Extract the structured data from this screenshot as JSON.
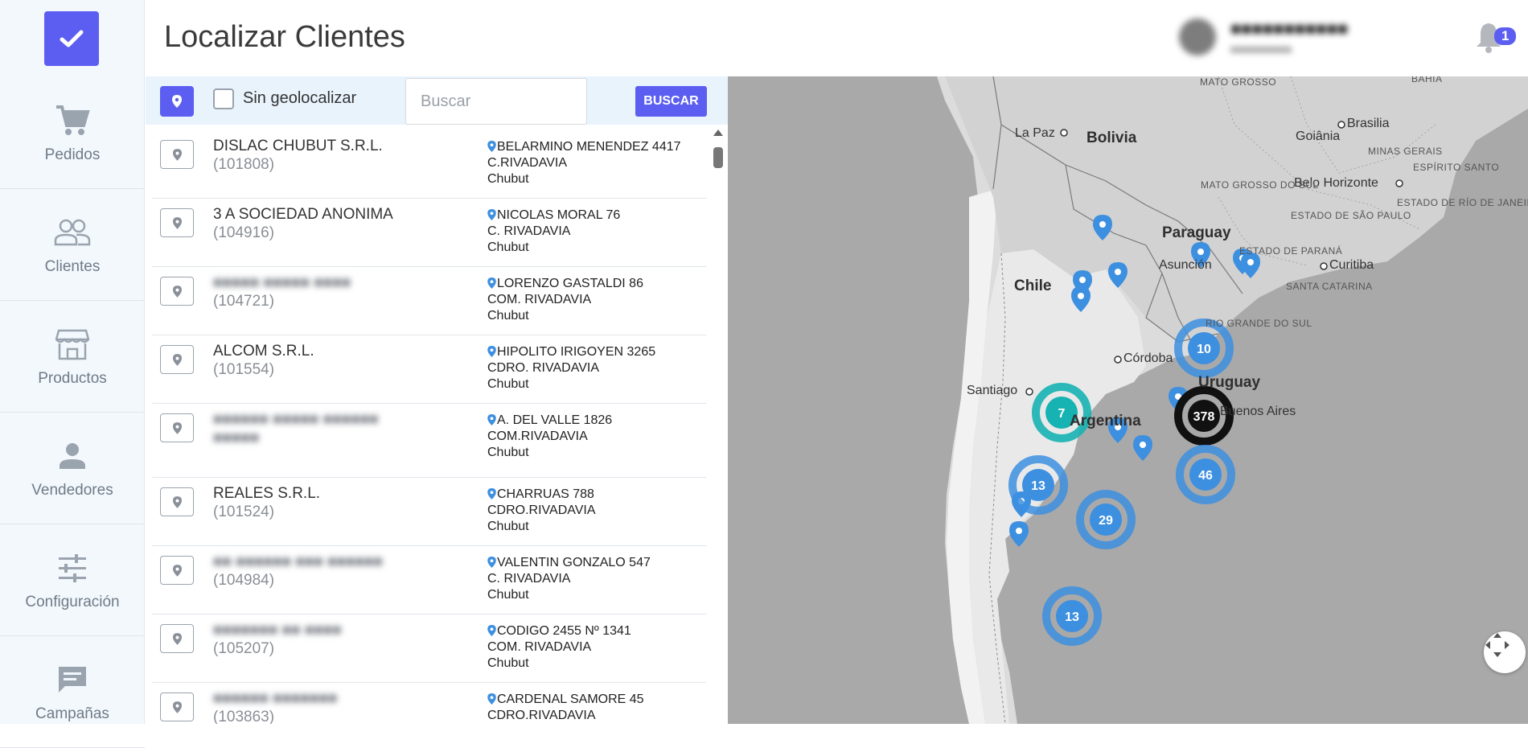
{
  "sidebar": {
    "items": [
      {
        "label": "Pedidos",
        "icon": "cart-icon"
      },
      {
        "label": "Clientes",
        "icon": "people-icon"
      },
      {
        "label": "Productos",
        "icon": "store-icon"
      },
      {
        "label": "Vendedores",
        "icon": "person-icon"
      },
      {
        "label": "Configuración",
        "icon": "sliders-icon"
      },
      {
        "label": "Campañas",
        "icon": "chat-icon"
      }
    ]
  },
  "header": {
    "title": "Localizar Clientes",
    "notifications_count": "1"
  },
  "filters": {
    "checkbox_label": "Sin geolocalizar",
    "search_placeholder": "Buscar",
    "search_button": "BUSCAR"
  },
  "clients": [
    {
      "name": "DISLAC CHUBUT S.R.L.",
      "code": "(101808)",
      "address": "BELARMINO MENENDEZ 4417",
      "city": "C.RIVADAVIA",
      "province": "Chubut"
    },
    {
      "name": "3 A SOCIEDAD ANONIMA",
      "code": "(104916)",
      "address": "NICOLAS MORAL 76",
      "city": "C. RIVADAVIA",
      "province": "Chubut"
    },
    {
      "name": "",
      "code": "(104721)",
      "address": "LORENZO GASTALDI 86",
      "city": "COM. RIVADAVIA",
      "province": "Chubut"
    },
    {
      "name": "ALCOM S.R.L.",
      "code": "(101554)",
      "address": "HIPOLITO IRIGOYEN 3265",
      "city": "CDRO. RIVADAVIA",
      "province": "Chubut"
    },
    {
      "name": "",
      "code": "",
      "address": "A. DEL VALLE 1826",
      "city": "COM.RIVADAVIA",
      "province": "Chubut"
    },
    {
      "name": "REALES S.R.L.",
      "code": "(101524)",
      "address": "CHARRUAS 788",
      "city": "CDRO.RIVADAVIA",
      "province": "Chubut"
    },
    {
      "name": "",
      "code": "(104984)",
      "address": "VALENTIN GONZALO 547",
      "city": "C. RIVADAVIA",
      "province": "Chubut"
    },
    {
      "name": "",
      "code": "(105207)",
      "address": "CODIGO 2455 Nº 1341",
      "city": "COM. RIVADAVIA",
      "province": "Chubut"
    },
    {
      "name": "",
      "code": "(103863)",
      "address": "CARDENAL SAMORE 45",
      "city": "CDRO.RIVADAVIA",
      "province": ""
    }
  ],
  "map": {
    "countries": [
      "Bolivia",
      "Paraguay",
      "Chile",
      "Uruguay",
      "Argentina"
    ],
    "cities": [
      "La Paz",
      "Brasilia",
      "Goiânia",
      "Belo Horizonte",
      "Asunción",
      "Curitiba",
      "Córdoba",
      "Santiago",
      "Buenos Aires"
    ],
    "regions": [
      "MINAS GERAIS",
      "MATO GROSSO DO SUL",
      "ESTADO DE SÃO PAULO",
      "ESTADO DE PARANÁ",
      "SANTA CATARINA",
      "RIO GRANDE DO SUL",
      "ESPÍRITO SANTO",
      "ESTADO DE RÍO DE JANEIRO",
      "MATO GROSSO",
      "BAHIA"
    ],
    "clusters": [
      "10",
      "378",
      "7",
      "46",
      "13",
      "29",
      "13"
    ]
  },
  "colors": {
    "accent": "#5b5ef0",
    "marker": "#3d8fe0",
    "cluster_teal": "#17b3b3"
  }
}
